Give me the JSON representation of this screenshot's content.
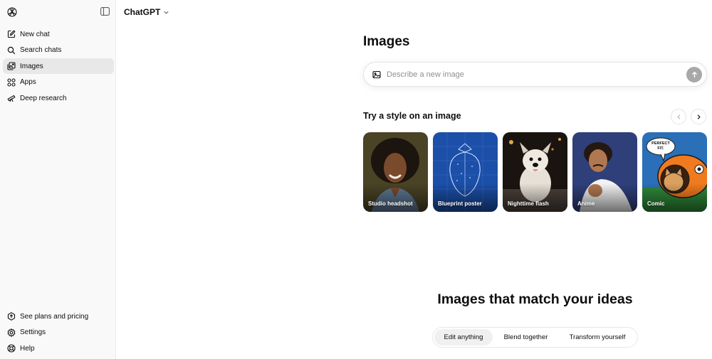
{
  "app": {
    "model_name": "ChatGPT"
  },
  "sidebar": {
    "items": [
      {
        "label": "New chat",
        "icon": "compose-icon"
      },
      {
        "label": "Search chats",
        "icon": "search-icon"
      },
      {
        "label": "Images",
        "icon": "images-icon",
        "active": true
      },
      {
        "label": "Apps",
        "icon": "apps-icon"
      },
      {
        "label": "Deep research",
        "icon": "telescope-icon"
      }
    ],
    "bottom_items": [
      {
        "label": "See plans and pricing",
        "icon": "upgrade-icon"
      },
      {
        "label": "Settings",
        "icon": "gear-icon"
      },
      {
        "label": "Help",
        "icon": "help-icon"
      }
    ]
  },
  "main": {
    "title": "Images",
    "composer": {
      "placeholder": "Describe a new image"
    },
    "styles_section": {
      "title": "Try a style on an image",
      "cards": [
        {
          "label": "Studio headshot"
        },
        {
          "label": "Blueprint poster"
        },
        {
          "label": "Nighttime flash"
        },
        {
          "label": "Anime"
        },
        {
          "label": "Comic",
          "bubble_text": "PERFECT FIT."
        }
      ]
    },
    "ideas": {
      "title": "Images that match your ideas",
      "tabs": [
        {
          "label": "Edit anything",
          "active": true
        },
        {
          "label": "Blend together"
        },
        {
          "label": "Transform yourself"
        }
      ]
    }
  },
  "colors": {
    "sidebar_bg": "#f9f9f9",
    "active_item_bg": "#e8e8e8",
    "send_button": "#a8a8a8",
    "blueprint": "#1b4fa8"
  }
}
